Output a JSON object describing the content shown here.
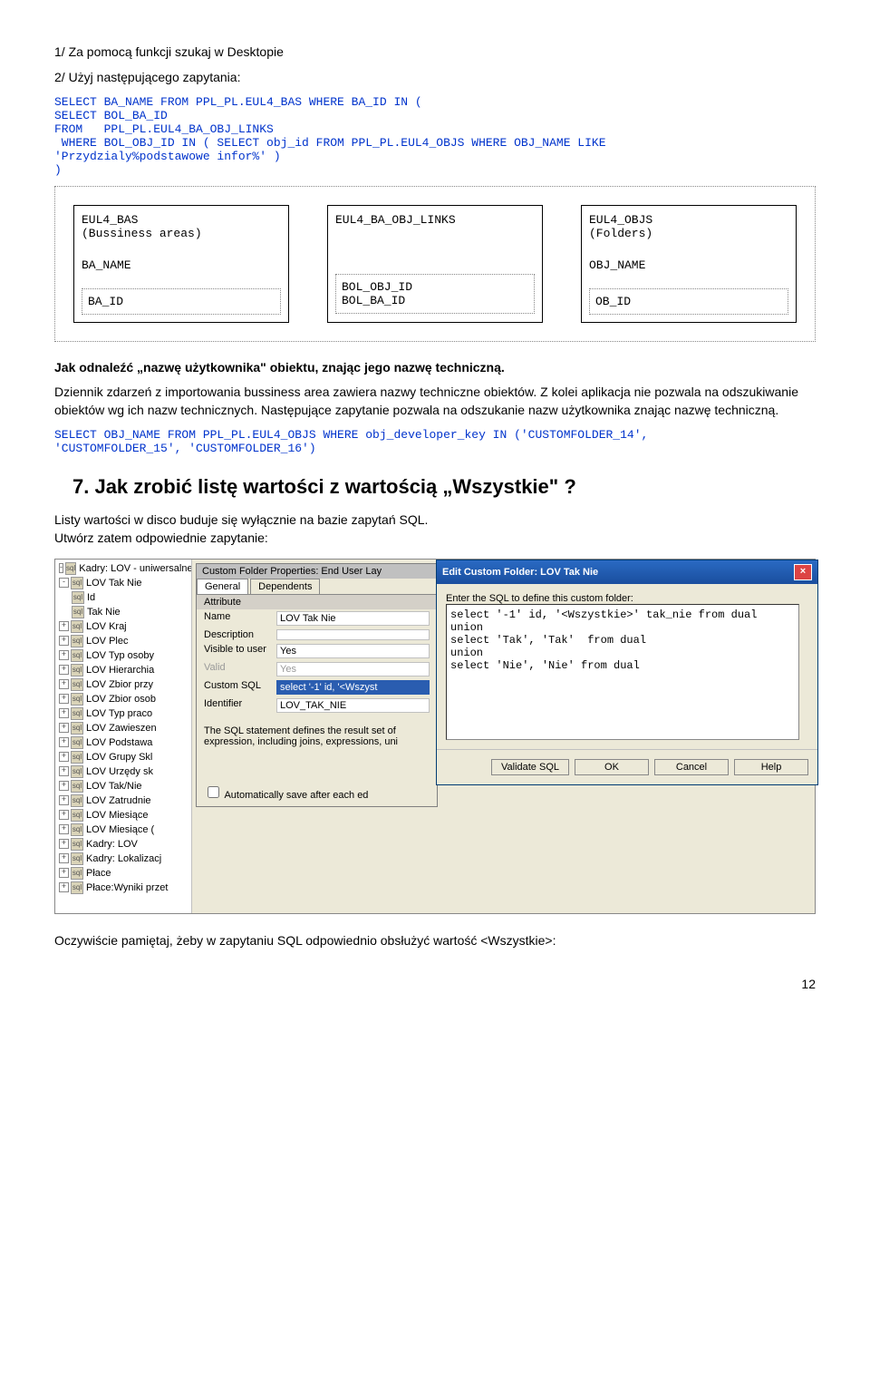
{
  "line1": "1/ Za pomocą funkcji szukaj w Desktopie",
  "line2": "2/ Użyj następującego zapytania:",
  "sql1": "SELECT BA_NAME FROM PPL_PL.EUL4_BAS WHERE BA_ID IN (\nSELECT BOL_BA_ID\nFROM   PPL_PL.EUL4_BA_OBJ_LINKS\n WHERE BOL_OBJ_ID IN ( SELECT obj_id FROM PPL_PL.EUL4_OBJS WHERE OBJ_NAME LIKE\n'Przydzialy%podstawowe infor%' )\n)",
  "diagram": {
    "box1_top": "EUL4_BAS\n(Bussiness areas)",
    "box1_mid": "BA_NAME",
    "box1_bot": "BA_ID",
    "box2_top": "EUL4_BA_OBJ_LINKS",
    "box2_mid": "",
    "box2_bot": "BOL_OBJ_ID\nBOL_BA_ID",
    "box3_top": "EUL4_OBJS\n(Folders)",
    "box3_mid": "OBJ_NAME",
    "box3_bot": "OB_ID"
  },
  "bold_para": "Jak odnaleźć „nazwę użytkownika\" obiektu, znając jego nazwę techniczną.",
  "para_after": "Dziennik zdarzeń z importowania bussiness area zawiera nazwy techniczne obiektów. Z kolei aplikacja nie pozwala na odszukiwanie obiektów wg ich nazw technicznych. Następujące zapytanie pozwala na odszukanie nazw użytkownika znając nazwę techniczną.",
  "sql2": "SELECT OBJ_NAME FROM PPL_PL.EUL4_OBJS WHERE obj_developer_key IN ('CUSTOMFOLDER_14',\n'CUSTOMFOLDER_15', 'CUSTOMFOLDER_16')",
  "heading7": "7. Jak zrobić listę wartości z wartością „Wszystkie\" ?",
  "para_listy": "Listy wartości w disco buduje się wyłącznie na bazie zapytań SQL.\nUtwórz zatem odpowiednie zapytanie:",
  "tree": {
    "root": "Kadry: LOV - uniwersalne",
    "items": [
      "LOV Tak Nie",
      "  Id",
      "  Tak Nie",
      "LOV Kraj",
      "LOV Plec",
      "LOV Typ osoby",
      "LOV Hierarchia",
      "LOV Zbior przy",
      "LOV Zbior osob",
      "LOV Typ praco",
      "LOV Zawieszen",
      "LOV Podstawa",
      "LOV Grupy Skl",
      "LOV Urzędy sk",
      "LOV Tak/Nie",
      "LOV Zatrudnie",
      "LOV Miesiące",
      "LOV Miesiące (",
      "Kadry: LOV",
      "Kadry: Lokalizacj",
      "Płace",
      "Płace:Wyniki przet"
    ]
  },
  "props": {
    "title": "Custom Folder Properties: End User Lay",
    "tabs": [
      "General",
      "Dependents"
    ],
    "rows": [
      {
        "k": "Name",
        "v": "LOV Tak Nie"
      },
      {
        "k": "Description",
        "v": ""
      },
      {
        "k": "Visible to user",
        "v": "Yes"
      },
      {
        "k": "Valid",
        "v": "Yes",
        "dis": true
      },
      {
        "k": "Custom SQL",
        "v": "select '-1' id, '<Wszyst",
        "sel": true
      },
      {
        "k": "Identifier",
        "v": "LOV_TAK_NIE"
      }
    ],
    "note": "The SQL statement defines the result set of expression, including joins, expressions, uni",
    "checkbox": "Automatically save after each ed",
    "attr_label": "Attribute"
  },
  "dialog": {
    "title": "Edit Custom Folder: LOV Tak Nie",
    "hint": "Enter the SQL to define this custom folder:",
    "sql": "select '-1' id, '<Wszystkie>' tak_nie from dual\nunion\nselect 'Tak', 'Tak'  from dual\nunion\nselect 'Nie', 'Nie' from dual",
    "buttons": [
      "Validate SQL",
      "OK",
      "Cancel",
      "Help"
    ]
  },
  "final_para": "Oczywiście pamiętaj, żeby w zapytaniu SQL odpowiednio obsłużyć wartość <Wszystkie>:",
  "page": "12"
}
